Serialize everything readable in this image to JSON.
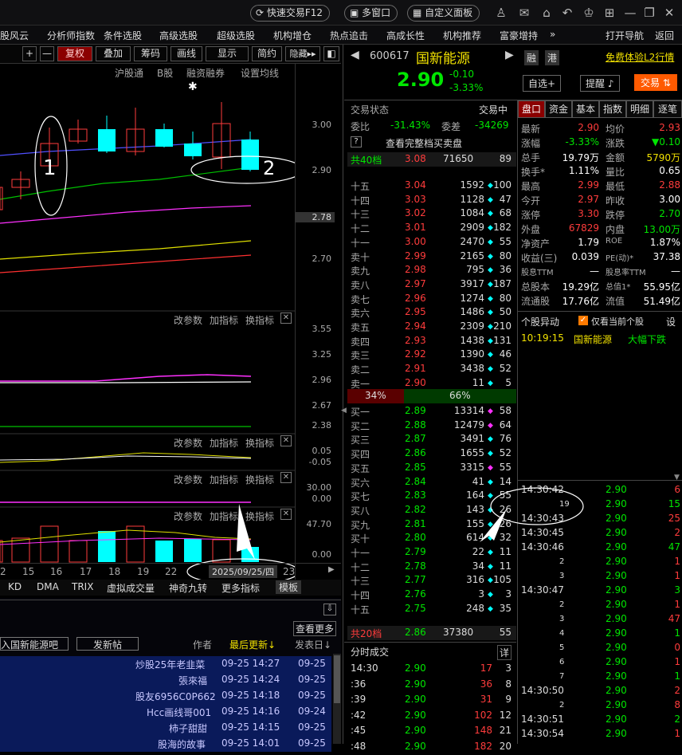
{
  "topbar": {
    "quick_trade": "快速交易F12",
    "multi_window": "多窗口",
    "custom_panel": "自定义面板"
  },
  "menu": [
    "股风云",
    "分析师指数",
    "条件选股",
    "高级选股",
    "超级选股",
    "机构增仓",
    "热点追击",
    "高成长性",
    "机构推荐",
    "富豪增持"
  ],
  "menu_right": {
    "more": "»",
    "nav": "打开导航",
    "back": "返回"
  },
  "chart_toolbar": {
    "plus": "+",
    "minus": "—",
    "fuquan": "复权",
    "overlay": "叠加",
    "chips": "筹码",
    "draw": "画线",
    "display": "显示",
    "simple": "简约",
    "hide": "隐藏▸▸"
  },
  "chart_sub": [
    "沪股通",
    "B股",
    "融资融券",
    "设置均线"
  ],
  "price_axis": [
    "3.00",
    "2.90",
    "2.78",
    "2.70"
  ],
  "ind1": {
    "params": "改参数",
    "add": "加指标",
    "switch": "换指标",
    "axis": [
      "3.55",
      "3.25",
      "2.96",
      "2.67",
      "2.38"
    ]
  },
  "ind2": {
    "params": "改参数",
    "add": "加指标",
    "switch": "换指标",
    "axis": [
      "0.05",
      "-0.05"
    ]
  },
  "ind3": {
    "params": "改参数",
    "add": "加指标",
    "switch": "换指标",
    "axis": [
      "30.00",
      "0.00"
    ]
  },
  "ind4": {
    "params": "改参数",
    "add": "加指标",
    "switch": "换指标",
    "axis": [
      "47.70",
      "0.00"
    ]
  },
  "date_ticks": [
    "2",
    "15",
    "16",
    "17",
    "18",
    "19",
    "22",
    "23"
  ],
  "date_cursor": "2025/09/25/四",
  "bottom_tabs": [
    "KD",
    "DMA",
    "TRIX",
    "虚拟成交量",
    "神奇九转",
    "更多指标",
    "模板"
  ],
  "forum": {
    "more": "查看更多",
    "link": "入国新能源吧",
    "post": "发新帖",
    "col_author": "作者",
    "col_last": "最后更新↓",
    "col_date": "发表日↓",
    "rows": [
      [
        "炒股25年老韭菜",
        "09-25 14:27",
        "09-25"
      ],
      [
        "張來福",
        "09-25 14:24",
        "09-25"
      ],
      [
        "股友6956C0P662",
        "09-25 14:18",
        "09-25"
      ],
      [
        "Hcc画线哥001",
        "09-25 14:16",
        "09-24"
      ],
      [
        "柿子甜甜",
        "09-25 14:15",
        "09-25"
      ],
      [
        "股海的故事",
        "09-25 14:01",
        "09-25"
      ]
    ]
  },
  "stock": {
    "code": "600617",
    "name": "国新能源",
    "price": "2.90",
    "change": "-0.10",
    "pct": "-3.33%",
    "tag1": "融",
    "tag2": "港",
    "l2": "免费体验L2行情",
    "watch": "自选+",
    "remind": "提醒",
    "trade": "交易"
  },
  "book": {
    "status": "交易状态",
    "status_val": "交易中",
    "ratio_label": "委比",
    "ratio": "-31.43%",
    "diff_label": "委差",
    "diff": "-34269",
    "full": "查看完整档买卖盘",
    "total_ask_label": "共40档",
    "total_ask_price": "3.08",
    "total_ask_vol": "71650",
    "total_ask_n": "89",
    "asks": [
      [
        "十五",
        "3.04",
        "1592",
        "100"
      ],
      [
        "十四",
        "3.03",
        "1128",
        "47"
      ],
      [
        "十三",
        "3.02",
        "1084",
        "68"
      ],
      [
        "十二",
        "3.01",
        "2909",
        "182"
      ],
      [
        "十一",
        "3.00",
        "2470",
        "55"
      ],
      [
        "卖十",
        "2.99",
        "2165",
        "80"
      ],
      [
        "卖九",
        "2.98",
        "795",
        "36"
      ],
      [
        "卖八",
        "2.97",
        "3917",
        "187"
      ],
      [
        "卖七",
        "2.96",
        "1274",
        "80"
      ],
      [
        "卖六",
        "2.95",
        "1486",
        "50"
      ],
      [
        "卖五",
        "2.94",
        "2309",
        "210"
      ],
      [
        "卖四",
        "2.93",
        "1438",
        "131"
      ],
      [
        "卖三",
        "2.92",
        "1390",
        "46"
      ],
      [
        "卖二",
        "2.91",
        "3438",
        "52"
      ],
      [
        "卖一",
        "2.90",
        "11",
        "5"
      ]
    ],
    "bar_left": "34%",
    "bar_right": "66%",
    "bids": [
      [
        "买一",
        "2.89",
        "13314",
        "58"
      ],
      [
        "买二",
        "2.88",
        "12479",
        "64"
      ],
      [
        "买三",
        "2.87",
        "3491",
        "76"
      ],
      [
        "买四",
        "2.86",
        "1655",
        "52"
      ],
      [
        "买五",
        "2.85",
        "3315",
        "55"
      ],
      [
        "买六",
        "2.84",
        "41",
        "14"
      ],
      [
        "买七",
        "2.83",
        "164",
        "55"
      ],
      [
        "买八",
        "2.82",
        "143",
        "26"
      ],
      [
        "买九",
        "2.81",
        "155",
        "26"
      ],
      [
        "买十",
        "2.80",
        "614",
        "32"
      ],
      [
        "十一",
        "2.79",
        "22",
        "11"
      ],
      [
        "十二",
        "2.78",
        "34",
        "11"
      ],
      [
        "十三",
        "2.77",
        "316",
        "105"
      ],
      [
        "十四",
        "2.76",
        "3",
        "3"
      ],
      [
        "十五",
        "2.75",
        "248",
        "35"
      ]
    ],
    "total_bid_label": "共20档",
    "total_bid_price": "2.86",
    "total_bid_vol": "37380",
    "total_bid_n": "55"
  },
  "tabs": [
    "盘口",
    "资金",
    "基本",
    "指数",
    "明细",
    "逐笔"
  ],
  "quote": [
    [
      "最新",
      "2.90",
      "均价",
      "2.93"
    ],
    [
      "涨幅",
      "-3.33%",
      "涨跌",
      "▼0.10"
    ],
    [
      "总手",
      "19.79万",
      "金额",
      "5790万"
    ],
    [
      "换手*",
      "1.11%",
      "量比",
      "0.65"
    ],
    [
      "最高",
      "2.99",
      "最低",
      "2.88"
    ],
    [
      "今开",
      "2.97",
      "昨收",
      "3.00"
    ],
    [
      "涨停",
      "3.30",
      "跌停",
      "2.70"
    ],
    [
      "外盘",
      "67829",
      "内盘",
      "13.00万"
    ],
    [
      "净资产",
      "1.79",
      "ROE",
      "1.87%"
    ],
    [
      "收益(三)",
      "0.039",
      "PE(动)*",
      "37.38"
    ],
    [
      "股息TTM",
      "—",
      "股息率TTM",
      "—"
    ],
    [
      "总股本",
      "19.29亿",
      "总值1*",
      "55.95亿"
    ],
    [
      "流通股",
      "17.76亿",
      "流值",
      "51.49亿"
    ]
  ],
  "alert": {
    "title": "个股异动",
    "only": "仅看当前个股",
    "set": "设",
    "time": "10:19:15",
    "name": "国新能源",
    "event": "大幅下跌"
  },
  "timetrade": {
    "title": "分时成交",
    "detail": "详",
    "rows": [
      [
        "14:30",
        "2.90",
        "17",
        "3"
      ],
      [
        ":36",
        "2.90",
        "36",
        "8"
      ],
      [
        ":39",
        "2.90",
        "31",
        "9"
      ],
      [
        ":42",
        "2.90",
        "102",
        "12"
      ],
      [
        ":45",
        "2.90",
        "148",
        "21"
      ],
      [
        ":48",
        "2.90",
        "182",
        "20"
      ]
    ]
  },
  "ticks": [
    [
      "14:30:42",
      "2.90",
      "6"
    ],
    [
      "19",
      "2.90",
      "15"
    ],
    [
      "14:30:43",
      "2.90",
      "25"
    ],
    [
      "14:30:45",
      "2.90",
      "2"
    ],
    [
      "14:30:46",
      "2.90",
      "47"
    ],
    [
      "2",
      "2.90",
      "1"
    ],
    [
      "3",
      "2.90",
      "1"
    ],
    [
      "14:30:47",
      "2.90",
      "3"
    ],
    [
      "2",
      "2.90",
      "1"
    ],
    [
      "3",
      "2.90",
      "47"
    ],
    [
      "4",
      "2.90",
      "1"
    ],
    [
      "5",
      "2.90",
      "0"
    ],
    [
      "6",
      "2.90",
      "1"
    ],
    [
      "7",
      "2.90",
      "1"
    ],
    [
      "14:30:50",
      "2.90",
      "2"
    ],
    [
      "2",
      "2.90",
      "8"
    ],
    [
      "14:30:51",
      "2.90",
      "2"
    ],
    [
      "14:30:54",
      "2.90",
      "1"
    ]
  ],
  "annotations": {
    "a1": "1",
    "a2": "2"
  }
}
